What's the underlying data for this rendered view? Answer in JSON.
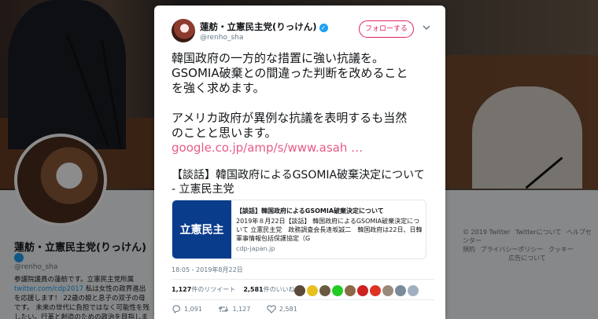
{
  "tweet": {
    "display_name": "蓮舫・立憲民主党(りっけん)",
    "handle": "@renho_sha",
    "follow_label": "フォローする",
    "lines": [
      "韓国政府の一方的な措置に強い抗議を。",
      "GSOMIA破棄との間違った判断を改めること",
      "を強く求めます。",
      "",
      "アメリカ政府が異例な抗議を表明するも当然",
      "のことと思います。"
    ],
    "inline_link": "google.co.jp/amp/s/www.asah …",
    "headline": "【談話】韓国政府によるGSOMIA破棄決定について - 立憲民主党",
    "timestamp": "18:05 - 2019年8月22日",
    "retweets_count": "1,127",
    "retweets_label": "件のリツイート",
    "likes_count": "2,581",
    "likes_label": "件のいいね",
    "reply_count": "1,091",
    "retweet_action_count": "1,127",
    "like_action_count": "2,581"
  },
  "link_card": {
    "image_text": "立憲民主",
    "title": "【談話】韓国政府によるGSOMIA破棄決定について",
    "description": "2019年８月22日【談話】 韓国政府によるGSOMIA破棄決定について 立憲民主党　政務調査会長逢坂誠二　韓国政府は22日、日韓軍事情報包括保護協定（G",
    "domain": "cdp-japan.jp"
  },
  "profile": {
    "name": "蓮舫・立憲民主党(りっけん)",
    "handle": "@renho_sha",
    "bio_line1": "参議院議員の蓮舫です。立憲民主党所属",
    "bio_link": "twitter.com/cdp2017",
    "bio_line2": " 私は女性の政界進出を応援します！ 22歳の娘と息子の双子の母です。 未来の世代に負担ではなく可能性を残したい。行革と創造のための政治を目指しま"
  },
  "footer": {
    "items": [
      "© 2019 Twitter",
      "Twitterについて",
      "ヘルプセンター",
      "規約",
      "プライバシーポリシー",
      "クッキー",
      "広告について"
    ]
  },
  "colors": {
    "accent": "#1da1f2",
    "follow": "#e0245e",
    "card_blue": "#0a3c8c"
  },
  "icons": [
    "verified-icon",
    "chevron-down-icon",
    "reply-icon",
    "retweet-icon",
    "like-icon"
  ]
}
